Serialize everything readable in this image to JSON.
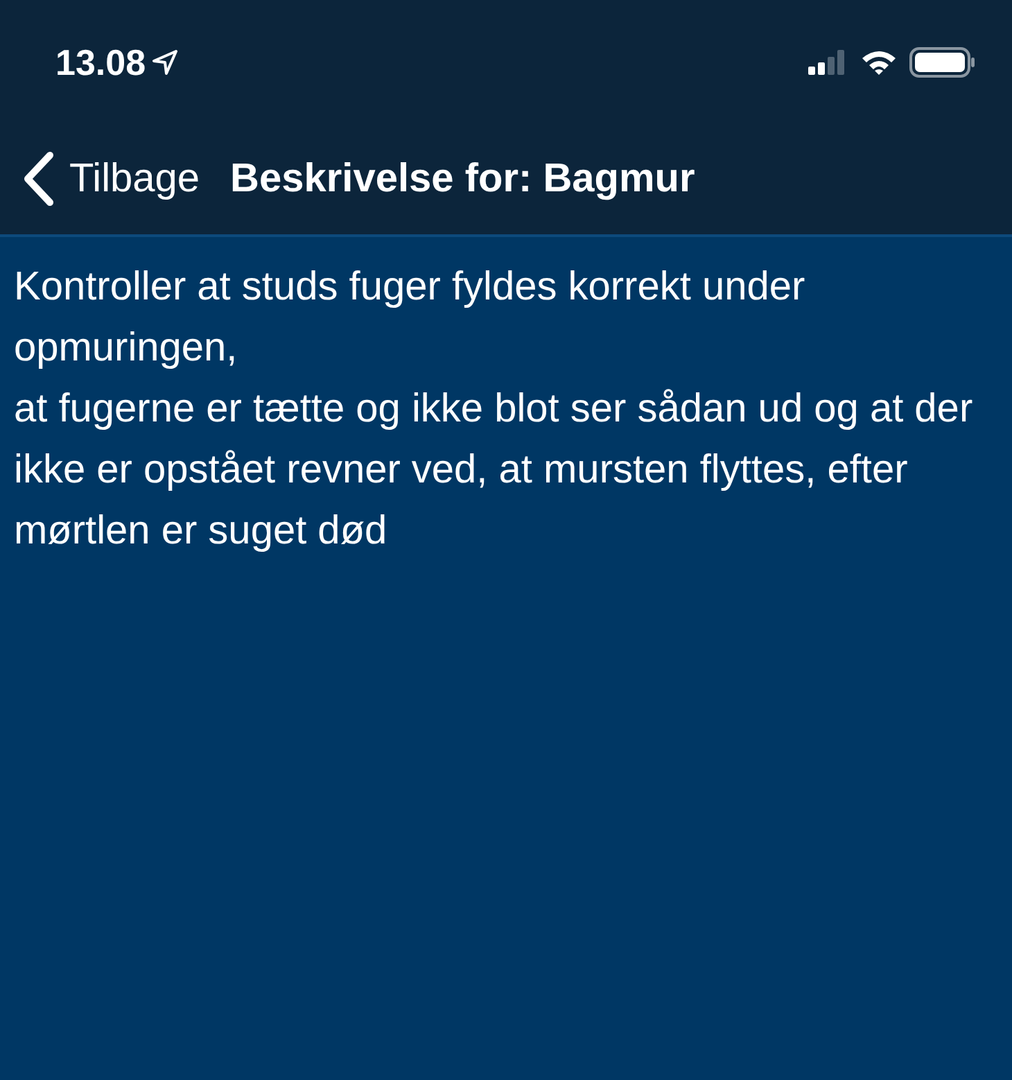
{
  "status_bar": {
    "time": "13.08"
  },
  "nav_bar": {
    "back_label": "Tilbage",
    "title": "Beskrivelse for: Bagmur"
  },
  "description": "Kontroller at studs fuger fyldes korrekt under opmuringen,\nat fugerne er tætte og ikke blot ser sådan ud og at der ikke er opstået revner ved, at mursten flyttes, efter mørtlen er suget død"
}
